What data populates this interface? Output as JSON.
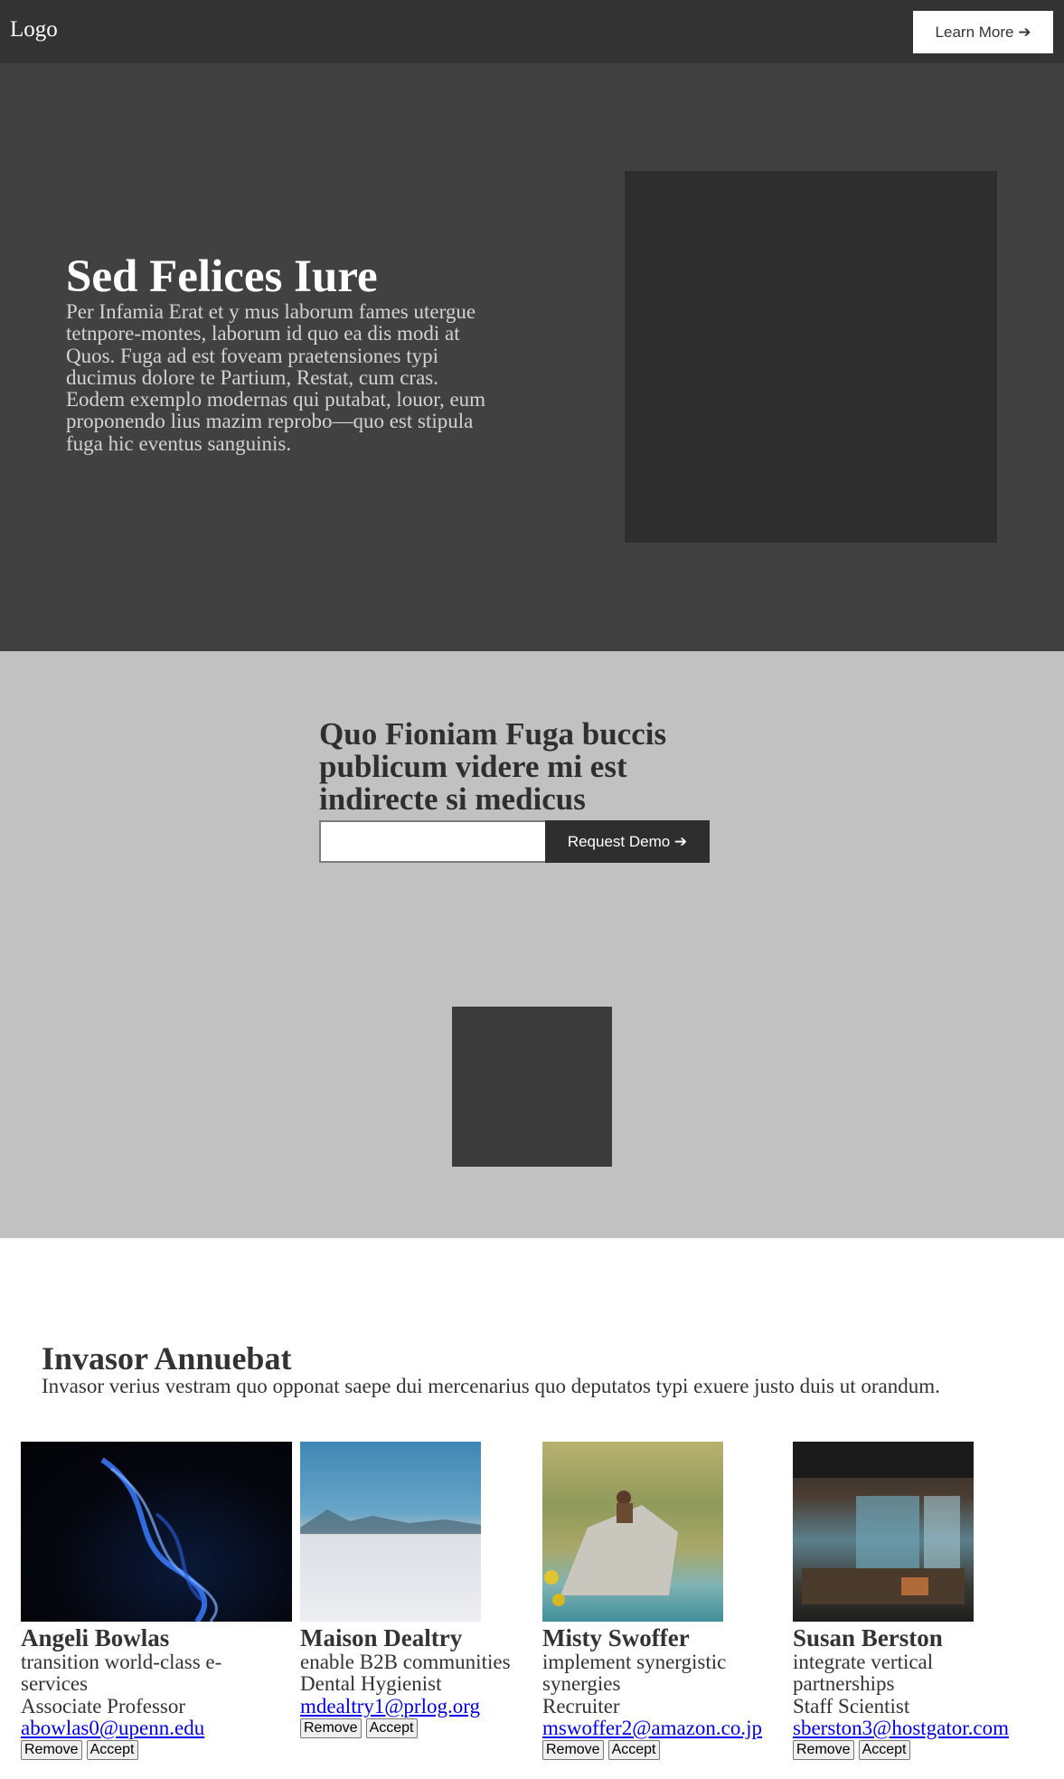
{
  "header": {
    "logo": "Logo",
    "learn_more_label": "Learn More ➔"
  },
  "hero": {
    "title": "Sed Felices Iure",
    "text": "Per Infamia Erat et y mus laborum fames utergue tetnpore-montes, laborum id quo ea dis modi at Quos. Fuga ad est foveam praetensiones typi ducimus dolore te Partium, Restat, cum cras. Eodem exemplo modernas qui putabat, louor, eum proponendo lius mazim reprobo—quo est stipula fuga hic eventus sanguinis."
  },
  "cta": {
    "title": "Quo Fioniam Fuga buccis publicum videre mi est indirecte si medicus",
    "input_value": "",
    "demo_label": "Request Demo ➔"
  },
  "team": {
    "title": "Invasor Annuebat",
    "subtitle": "Invasor verius vestram quo opponat saepe dui mercenarius quo deputatos typi exuere justo duis ut orandum.",
    "remove_label": "Remove",
    "accept_label": "Accept",
    "members": [
      {
        "name": "Angeli Bowlas",
        "tagline": "transition world-class e-services",
        "role": "Associate Professor",
        "email": "abowlas0@upenn.edu",
        "photo": "blue-smoke-photo"
      },
      {
        "name": "Maison Dealtry",
        "tagline": "enable B2B communities",
        "role": "Dental Hygienist",
        "email": "mdealtry1@prlog.org",
        "photo": "salt-flat-photo"
      },
      {
        "name": "Misty Swoffer",
        "tagline": "implement synergistic synergies",
        "role": "Recruiter",
        "email": "mswoffer2@amazon.co.jp",
        "photo": "lake-rock-photo"
      },
      {
        "name": "Susan Berston",
        "tagline": "integrate vertical partnerships",
        "role": "Staff Scientist",
        "email": "sberston3@hostgator.com",
        "photo": "workshop-photo"
      }
    ]
  }
}
